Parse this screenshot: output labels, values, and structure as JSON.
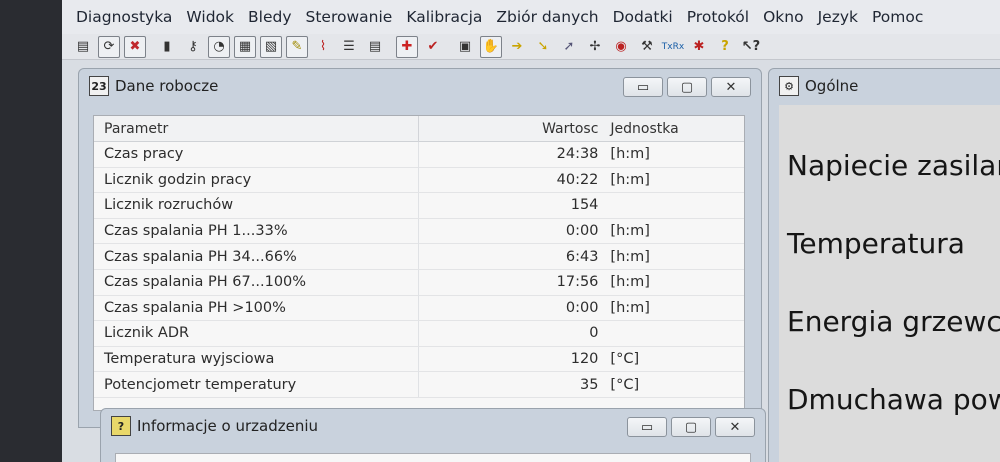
{
  "menu": [
    "Diagnostyka",
    "Widok",
    "Bledy",
    "Sterowanie",
    "Kalibracja",
    "Zbiór danych",
    "Dodatki",
    "Protokól",
    "Okno",
    "Jezyk",
    "Pomoc"
  ],
  "toolbar": {
    "icons": [
      "print-icon",
      "refresh-icon",
      "stop-icon",
      "device-icon",
      "key-icon",
      "gauge-icon",
      "chart-icon",
      "table-icon",
      "note-icon",
      "graph-icon",
      "list-icon",
      "doc-icon",
      "add-icon",
      "check-icon",
      "terminal-icon",
      "hand-icon",
      "arrow-icon",
      "arrow-down-icon",
      "arrow-fuel-icon",
      "fan-icon",
      "co2-icon",
      "hammer-icon",
      "tx-rx-icon",
      "bug-icon",
      "help-icon",
      "whats-this-icon"
    ],
    "txrx_label": "TxRx"
  },
  "window_dane": {
    "title": "Dane robocze",
    "icon_text": "23",
    "controls": [
      "▭",
      "▢",
      "✕"
    ],
    "columns": {
      "param": "Parametr",
      "value": "Wartosc",
      "unit": "Jednostka"
    },
    "rows": [
      {
        "param": "Czas pracy",
        "value": "24:38",
        "unit": "[h:m]"
      },
      {
        "param": "Licznik godzin pracy",
        "value": "40:22",
        "unit": "[h:m]"
      },
      {
        "param": "Licznik rozruchów",
        "value": "154",
        "unit": ""
      },
      {
        "param": "Czas spalania PH 1...33%",
        "value": "0:00",
        "unit": "[h:m]"
      },
      {
        "param": "Czas spalania PH 34...66%",
        "value": "6:43",
        "unit": "[h:m]"
      },
      {
        "param": "Czas spalania PH 67...100%",
        "value": "17:56",
        "unit": "[h:m]"
      },
      {
        "param": "Czas spalania PH >100%",
        "value": "0:00",
        "unit": "[h:m]"
      },
      {
        "param": "Licznik ADR",
        "value": "0",
        "unit": ""
      },
      {
        "param": "Temperatura wyjsciowa",
        "value": "120",
        "unit": "[°C]"
      },
      {
        "param": "Potencjometr temperatury",
        "value": "35",
        "unit": "[°C]"
      }
    ]
  },
  "window_info": {
    "title": "Informacje o urzadzeniu",
    "icon_text": "?",
    "controls": [
      "▭",
      "▢",
      "✕"
    ]
  },
  "window_ogolne": {
    "title": "Ogólne",
    "labels": [
      "Napiecie zasilar",
      "Temperatura",
      "Energia grzewcz",
      "Dmuchawa powi"
    ]
  }
}
